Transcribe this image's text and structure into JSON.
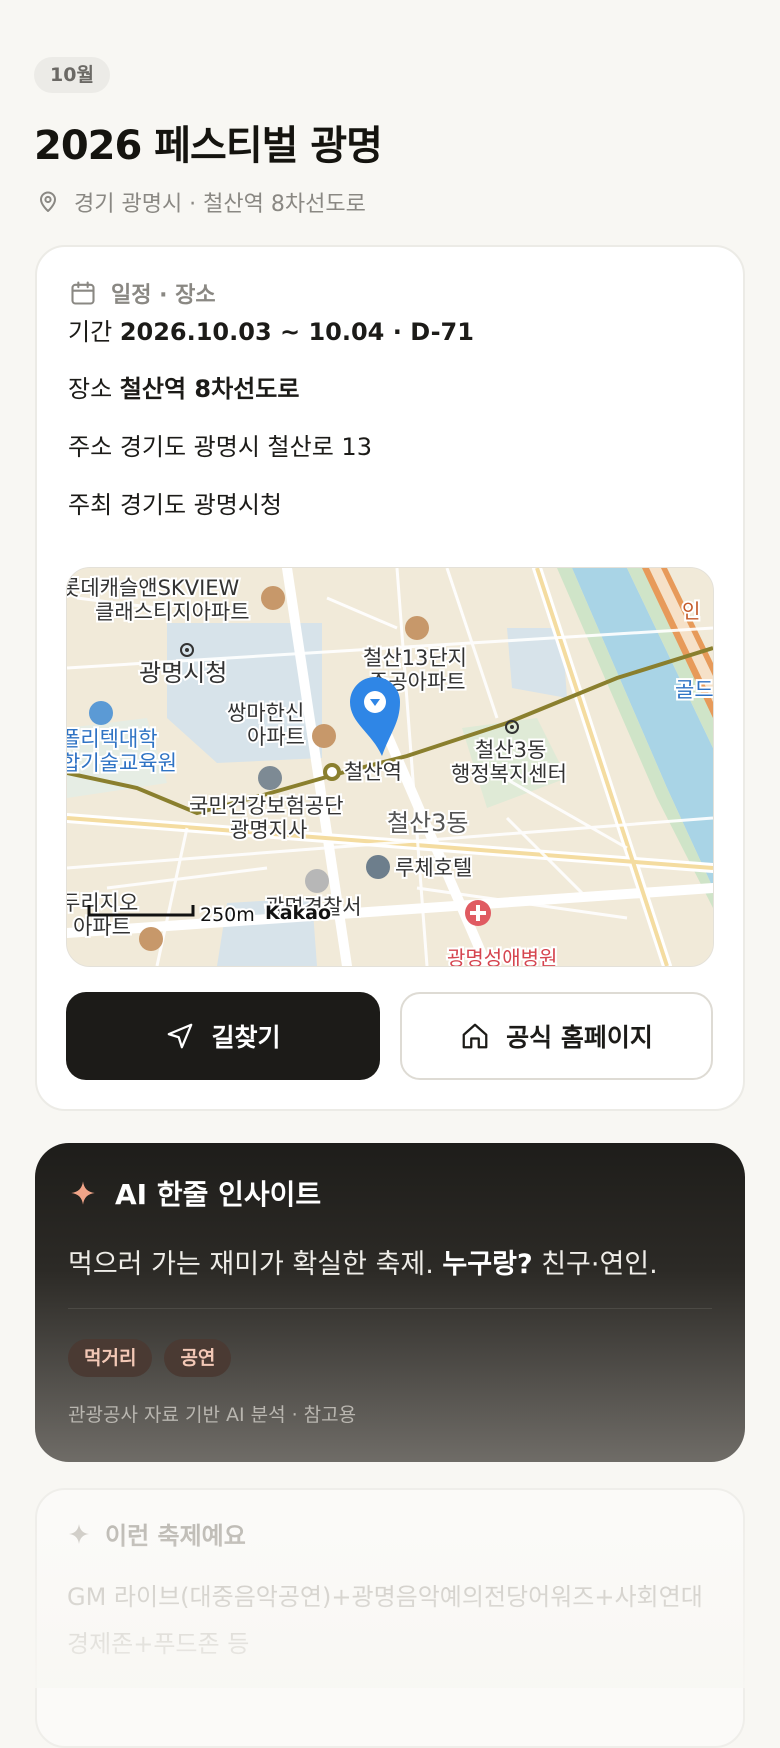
{
  "header": {
    "month_badge": "10월",
    "title": "2026 페스티벌 광명",
    "location": "경기 광명시 · 철산역 8차선도로"
  },
  "info_card": {
    "heading": "일정 · 장소",
    "period_label": "기간",
    "period_value": "2026.10.03 ~ 10.04 · D-71",
    "venue_label": "장소",
    "venue_value": "철산역 8차선도로",
    "address_label": "주소",
    "address_value": "경기도 광명시 철산로 13",
    "host_label": "주최",
    "host_value": "경기도 광명시청",
    "map": {
      "labels": {
        "apt1_line1": "롯데캐슬앤SKVIEW",
        "apt1_line2": "클래스티지아파트",
        "city_hall": "광명시청",
        "polytech_line1": "폴리텍대학",
        "polytech_line2": "합기술교육원",
        "ssangma_line1": "쌍마한신",
        "ssangma_line2": "아파트",
        "cheolsan13_line1": "철산13단지",
        "cheolsan13_line2": "주공아파트",
        "station": "철산역",
        "welfare_line1": "철산3동",
        "welfare_line2": "행정복지센터",
        "nhis_line1": "국민건강보험공단",
        "nhis_line2": "광명지사",
        "district": "철산3동",
        "hotel": "루체호텔",
        "police": "광명경찰서",
        "apt_bottom_line1": "두리지오",
        "apt_bottom_line2": "아파트",
        "hospital": "광명성애병원",
        "edge_top_right": "인",
        "edge_right": "골드",
        "scale": "250m",
        "brand": "Kakao"
      }
    },
    "buttons": {
      "directions": "길찾기",
      "homepage": "공식 홈페이지"
    }
  },
  "ai_insight": {
    "heading": "AI 한줄 인사이트",
    "text_before": "먹으러 가는 재미가 확실한 축제. ",
    "text_bold": "누구랑?",
    "text_after": " 친구·연인.",
    "tags": [
      "먹거리",
      "공연"
    ],
    "note": "관광공사 자료 기반 AI 분석 · 참고용"
  },
  "similar": {
    "heading": "이런 축제예요",
    "text": "GM 라이브(대중음악공연)+광명음악예의전당어워즈+사회연대경제존+푸드존 등"
  },
  "colors": {
    "accent": "#f0a488",
    "pin": "#2f86e6",
    "dark": "#1c1b18"
  }
}
